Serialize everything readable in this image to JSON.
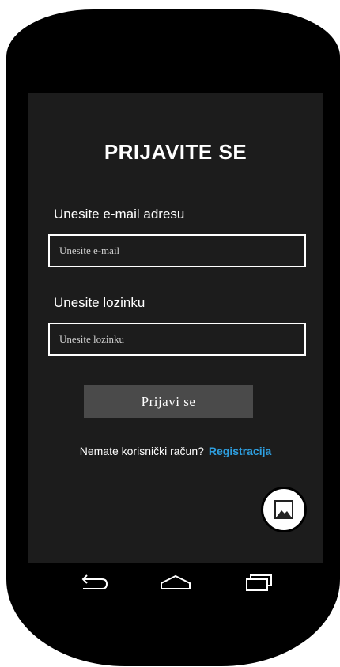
{
  "screen": {
    "title": "PRIJAVITE SE",
    "email": {
      "label": "Unesite e-mail adresu",
      "placeholder": "Unesite e-mail",
      "value": ""
    },
    "password": {
      "label": "Unesite lozinku",
      "placeholder": "Unesite lozinku",
      "value": ""
    },
    "login_button": "Prijavi se",
    "register": {
      "prompt": "Nemate korisnički račun?",
      "link": "Registracija"
    },
    "fab_icon": "image-icon"
  },
  "navbar": {
    "icons": [
      "back-icon",
      "home-icon",
      "recent-apps-icon"
    ]
  },
  "colors": {
    "background": "#1c1c1c",
    "link": "#2e9fe0",
    "button": "#4a4a4a",
    "frame": "#000000"
  }
}
